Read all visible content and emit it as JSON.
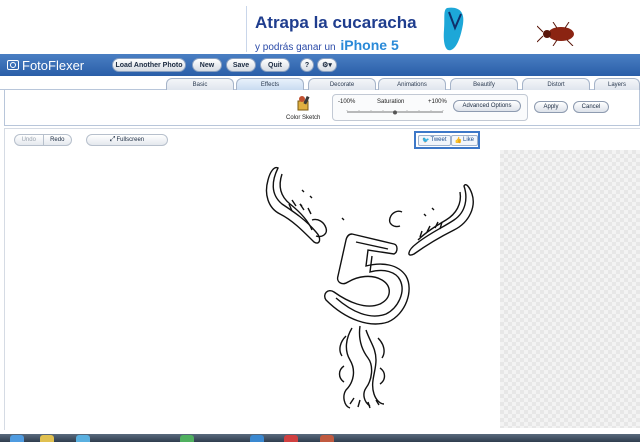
{
  "ad": {
    "title": "Atrapa la cucaracha",
    "subtitle": "y podrás ganar un",
    "prize": "iPhone 5"
  },
  "app": {
    "logo_text": "FotoFlexer"
  },
  "toolbar": {
    "load_label": "Load Another Photo",
    "new_label": "New",
    "save_label": "Save",
    "quit_label": "Quit",
    "help_label": "?",
    "settings_label": "⚙▾"
  },
  "tabs": [
    {
      "label": "Basic"
    },
    {
      "label": "Effects"
    },
    {
      "label": "Decorate"
    },
    {
      "label": "Animations"
    },
    {
      "label": "Beautify"
    },
    {
      "label": "Distort"
    },
    {
      "label": "Layers"
    }
  ],
  "effects_panel": {
    "effect_name": "Color Sketch",
    "saturation_label": "Saturation",
    "saturation_min": "-100%",
    "saturation_max": "+100%",
    "saturation_value": 0,
    "advanced_label": "Advanced Options",
    "apply_label": "Apply",
    "cancel_label": "Cancel"
  },
  "edit_bar": {
    "undo_label": "Undo",
    "redo_label": "Redo",
    "fullscreen_label": "Fullscreen",
    "tweet_label": "Tweet",
    "like_label": "Like"
  },
  "colors": {
    "brand_blue": "#2a5ea8",
    "ad_title": "#1f3d8e",
    "share_border": "#3d78c8"
  }
}
